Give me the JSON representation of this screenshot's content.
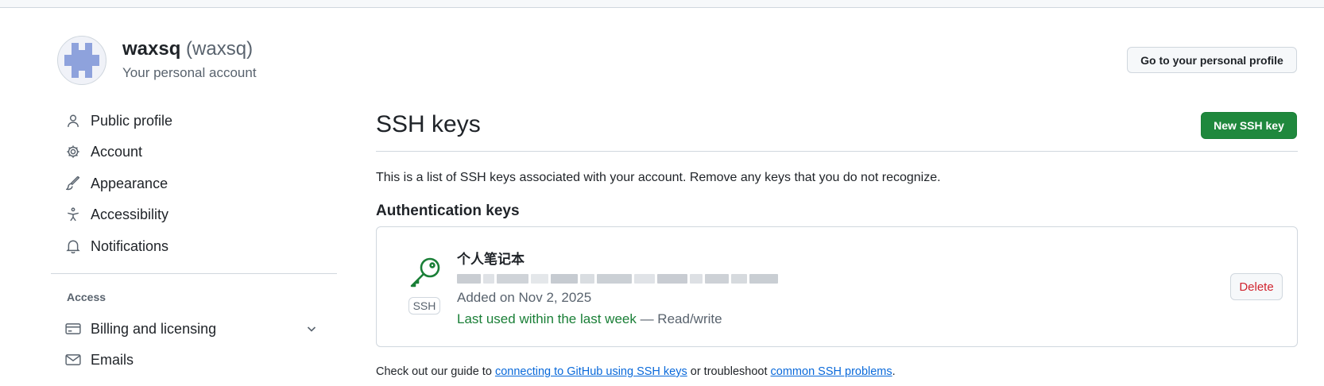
{
  "header": {
    "display_name": "waxsq",
    "login": "(waxsq)",
    "subtitle": "Your personal account",
    "profile_button": "Go to your personal profile"
  },
  "sidebar": {
    "items": [
      {
        "label": "Public profile",
        "icon": "person-icon"
      },
      {
        "label": "Account",
        "icon": "gear-icon"
      },
      {
        "label": "Appearance",
        "icon": "paintbrush-icon"
      },
      {
        "label": "Accessibility",
        "icon": "accessibility-icon"
      },
      {
        "label": "Notifications",
        "icon": "bell-icon"
      }
    ],
    "access_heading": "Access",
    "access_items": [
      {
        "label": "Billing and licensing",
        "icon": "credit-card-icon",
        "expandable": true
      },
      {
        "label": "Emails",
        "icon": "mail-icon"
      }
    ]
  },
  "main": {
    "title": "SSH keys",
    "new_button": "New SSH key",
    "description": "This is a list of SSH keys associated with your account. Remove any keys that you do not recognize.",
    "section_heading": "Authentication keys",
    "key": {
      "title": "个人笔记本",
      "badge": "SSH",
      "added": "Added on Nov 2, 2025",
      "last_used": "Last used within the last week",
      "access": " — Read/write",
      "delete_button": "Delete"
    },
    "footer": {
      "prefix": "Check out our guide to ",
      "link1": "connecting to GitHub using SSH keys",
      "middle": " or troubleshoot ",
      "link2": "common SSH problems",
      "suffix": "."
    }
  },
  "colors": {
    "primary_button": "#1f883d",
    "link": "#0969da",
    "danger": "#d1242f",
    "success_text": "#1a7f37"
  }
}
